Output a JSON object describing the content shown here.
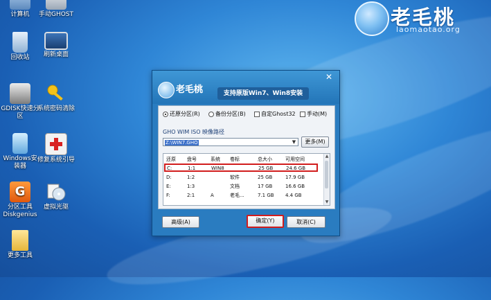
{
  "desktop": {
    "icons": [
      {
        "label": "计算机"
      },
      {
        "label": "手动GHOST"
      },
      {
        "label": "回收站"
      },
      {
        "label": "刷新桌面"
      },
      {
        "label": "GDISK快速分区"
      },
      {
        "label": "系统密码清除"
      },
      {
        "label": "Windows安装器"
      },
      {
        "label": "修复系统引导"
      },
      {
        "label": "分区工具Diskgenius"
      },
      {
        "label": "虚拟光驱"
      },
      {
        "label": "更多工具"
      }
    ]
  },
  "logo": {
    "title": "老毛桃",
    "url": "laomaotao.org"
  },
  "dialog": {
    "brand": "老毛桃",
    "slogan": "支持原版Win7、Win8安装",
    "close": "✕",
    "options": {
      "restore": "还原分区(R)",
      "backup": "备份分区(B)",
      "custom_ghost": "自定Ghost32",
      "manual": "手动(M)"
    },
    "path_label": "GHO WIM ISO 映像路径",
    "path_value": "Z:\\WIN7.GHO",
    "more_button": "更多(M)",
    "table": {
      "headers": [
        "还原",
        "盘号",
        "系统",
        "卷标",
        "总大小",
        "可用空间"
      ],
      "rows": [
        [
          "C:",
          "1:1",
          "WIN8",
          "",
          "25 GB",
          "24.6 GB"
        ],
        [
          "D:",
          "1:2",
          "",
          "软件",
          "25 GB",
          "17.9 GB"
        ],
        [
          "E:",
          "1:3",
          "",
          "文档",
          "17 GB",
          "16.6 GB"
        ],
        [
          "F:",
          "2:1",
          "A",
          "老毛...",
          "7.1 GB",
          "4.4 GB"
        ]
      ]
    },
    "advanced_button": "高级(A)",
    "confirm_button": "确定(Y)",
    "cancel_button": "取消(C)"
  },
  "colors": {
    "desktop_blue": "#2f86d6",
    "dialog_blue": "#2a7cc0",
    "highlight_red": "#d11c1c"
  }
}
